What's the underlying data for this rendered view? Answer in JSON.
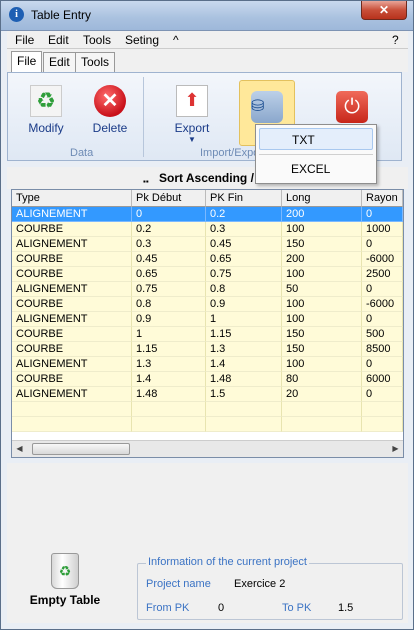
{
  "window": {
    "title": "Table Entry",
    "close_glyph": "✕",
    "app_icon": "i"
  },
  "menu": {
    "items": [
      "File",
      "Edit",
      "Tools",
      "Seting",
      "^"
    ],
    "help": "?"
  },
  "tabs": [
    "File",
    "Edit",
    "Tools"
  ],
  "ribbon": {
    "groups": [
      "Data",
      "Import/Expo"
    ],
    "buttons": {
      "modify": "Modify",
      "delete": "Delete",
      "export": "Export"
    }
  },
  "dropdown": {
    "items": [
      "TXT",
      "EXCEL"
    ]
  },
  "sort_label": "Sort Ascending /",
  "table": {
    "columns": [
      "Type",
      "Pk Début",
      "PK Fin",
      "Long",
      "Rayon"
    ],
    "rows": [
      [
        "ALIGNEMENT",
        "0",
        "0.2",
        "200",
        "0"
      ],
      [
        "COURBE",
        "0.2",
        "0.3",
        "100",
        "1000"
      ],
      [
        "ALIGNEMENT",
        "0.3",
        "0.45",
        "150",
        "0"
      ],
      [
        "COURBE",
        "0.45",
        "0.65",
        "200",
        "-6000"
      ],
      [
        "COURBE",
        "0.65",
        "0.75",
        "100",
        "2500"
      ],
      [
        "ALIGNEMENT",
        "0.75",
        "0.8",
        "50",
        "0"
      ],
      [
        "COURBE",
        "0.8",
        "0.9",
        "100",
        "-6000"
      ],
      [
        "ALIGNEMENT",
        "0.9",
        "1",
        "100",
        "0"
      ],
      [
        "COURBE",
        "1",
        "1.15",
        "150",
        "500"
      ],
      [
        "COURBE",
        "1.15",
        "1.3",
        "150",
        "8500"
      ],
      [
        "ALIGNEMENT",
        "1.3",
        "1.4",
        "100",
        "0"
      ],
      [
        "COURBE",
        "1.4",
        "1.48",
        "80",
        "6000"
      ],
      [
        "ALIGNEMENT",
        "1.48",
        "1.5",
        "20",
        "0"
      ]
    ],
    "selected_row": 0
  },
  "empty_table": "Empty Table",
  "project": {
    "legend": "Information of the current project",
    "name_label": "Project name",
    "name_value": "Exercice 2",
    "from_label": "From PK",
    "from_value": "0",
    "to_label": "To PK",
    "to_value": "1.5"
  }
}
